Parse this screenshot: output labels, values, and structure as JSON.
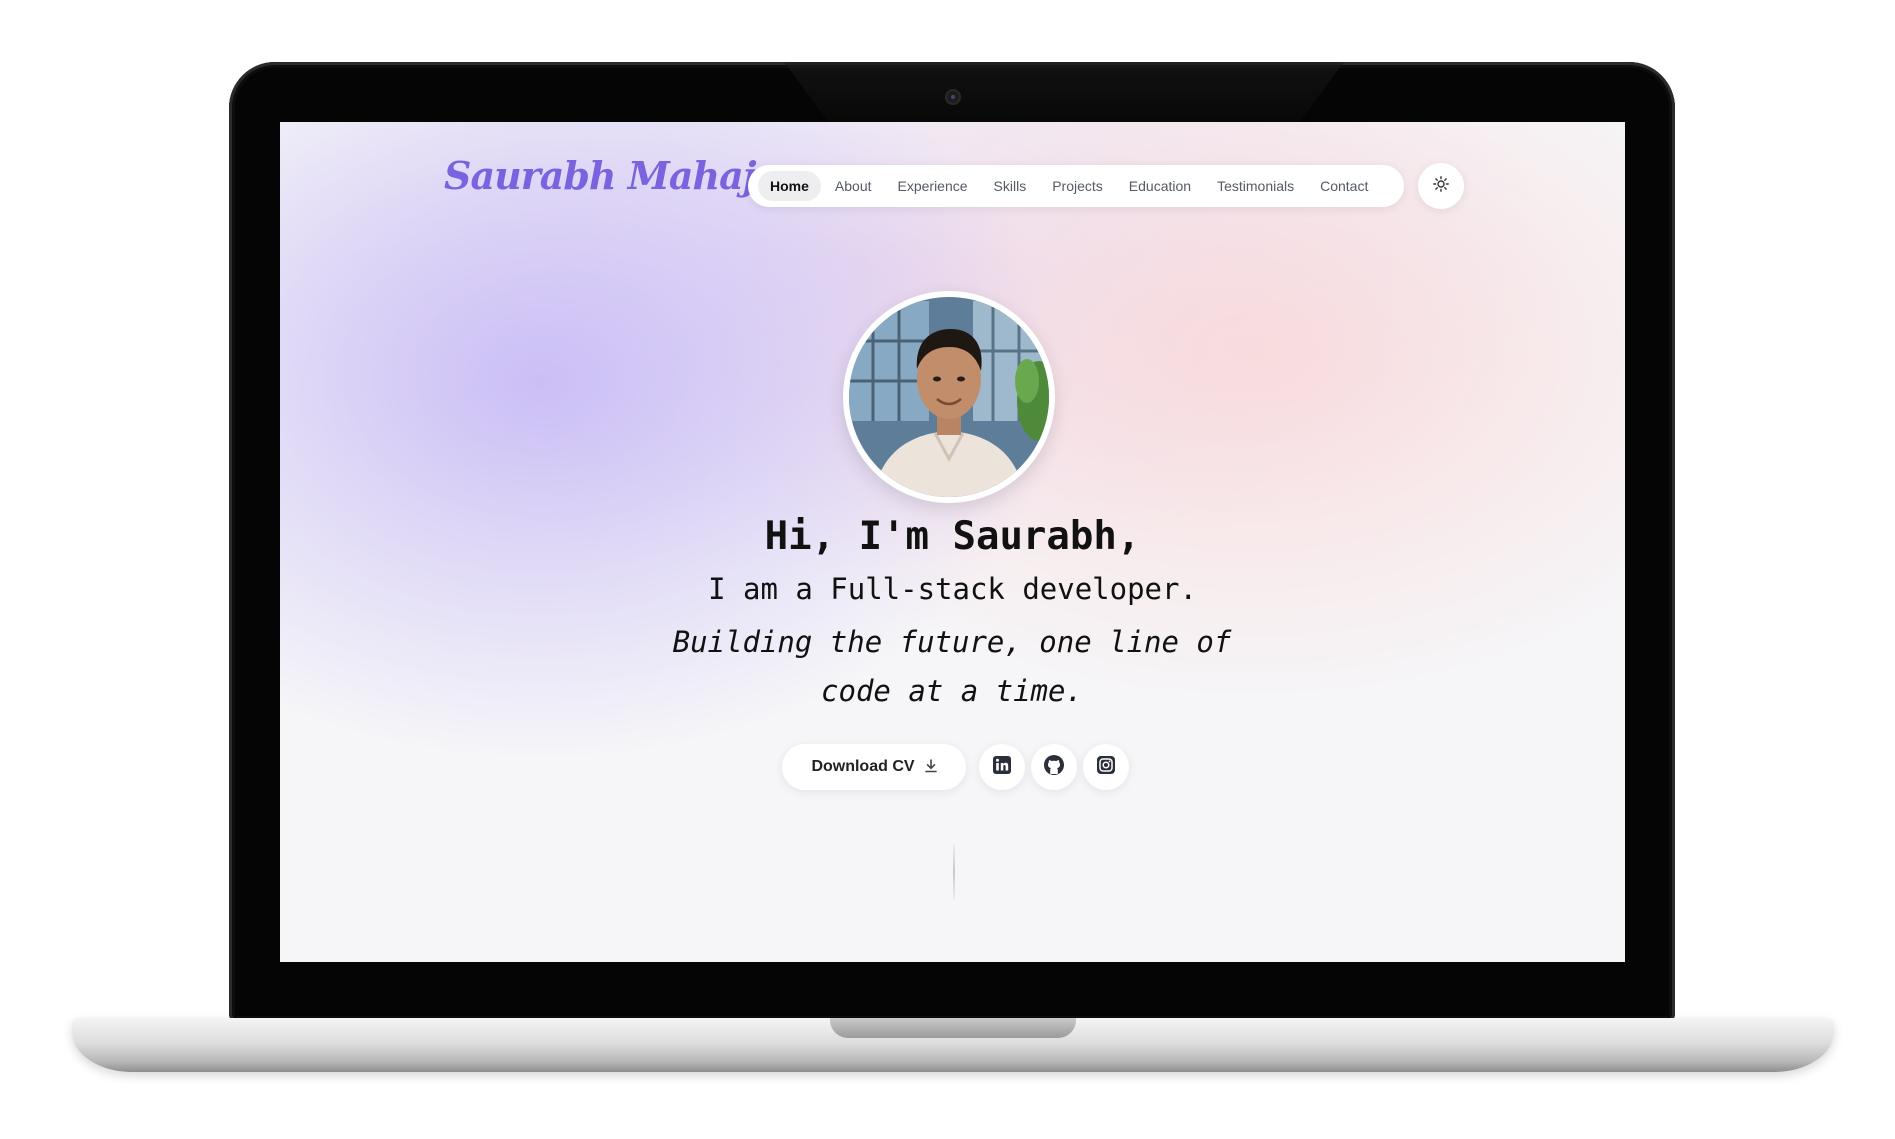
{
  "site": {
    "logo_text": "Saurabh Mahajan"
  },
  "nav": {
    "items": [
      {
        "label": "Home",
        "active": true
      },
      {
        "label": "About"
      },
      {
        "label": "Experience"
      },
      {
        "label": "Skills"
      },
      {
        "label": "Projects"
      },
      {
        "label": "Education"
      },
      {
        "label": "Testimonials"
      },
      {
        "label": "Contact"
      }
    ],
    "theme_toggle_icon": "sun-icon"
  },
  "hero": {
    "greeting": "Hi, I'm Saurabh,",
    "role": "I am a Full-stack developer.",
    "tagline": "Building the future, one line of code at a time.",
    "cv_button_label": "Download CV",
    "cv_button_icon": "download-icon",
    "social_icons": [
      "linkedin-icon",
      "github-icon",
      "instagram-icon"
    ]
  },
  "colors": {
    "brand": "#7b63e0",
    "text": "#111111",
    "laptop_bezel": "#050505"
  }
}
